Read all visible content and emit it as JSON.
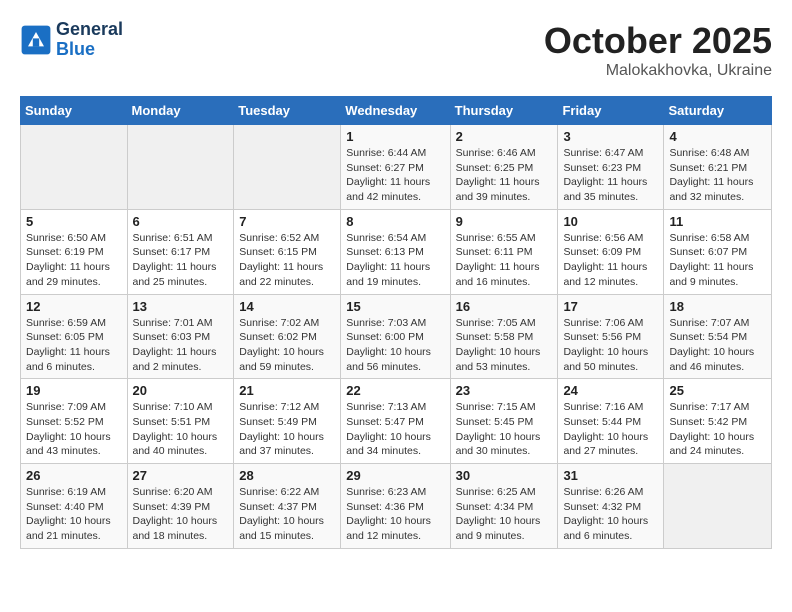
{
  "header": {
    "logo_line1": "General",
    "logo_line2": "Blue",
    "title": "October 2025",
    "subtitle": "Malokakhovka, Ukraine"
  },
  "weekdays": [
    "Sunday",
    "Monday",
    "Tuesday",
    "Wednesday",
    "Thursday",
    "Friday",
    "Saturday"
  ],
  "weeks": [
    [
      {
        "day": "",
        "info": ""
      },
      {
        "day": "",
        "info": ""
      },
      {
        "day": "",
        "info": ""
      },
      {
        "day": "1",
        "info": "Sunrise: 6:44 AM\nSunset: 6:27 PM\nDaylight: 11 hours and 42 minutes."
      },
      {
        "day": "2",
        "info": "Sunrise: 6:46 AM\nSunset: 6:25 PM\nDaylight: 11 hours and 39 minutes."
      },
      {
        "day": "3",
        "info": "Sunrise: 6:47 AM\nSunset: 6:23 PM\nDaylight: 11 hours and 35 minutes."
      },
      {
        "day": "4",
        "info": "Sunrise: 6:48 AM\nSunset: 6:21 PM\nDaylight: 11 hours and 32 minutes."
      }
    ],
    [
      {
        "day": "5",
        "info": "Sunrise: 6:50 AM\nSunset: 6:19 PM\nDaylight: 11 hours and 29 minutes."
      },
      {
        "day": "6",
        "info": "Sunrise: 6:51 AM\nSunset: 6:17 PM\nDaylight: 11 hours and 25 minutes."
      },
      {
        "day": "7",
        "info": "Sunrise: 6:52 AM\nSunset: 6:15 PM\nDaylight: 11 hours and 22 minutes."
      },
      {
        "day": "8",
        "info": "Sunrise: 6:54 AM\nSunset: 6:13 PM\nDaylight: 11 hours and 19 minutes."
      },
      {
        "day": "9",
        "info": "Sunrise: 6:55 AM\nSunset: 6:11 PM\nDaylight: 11 hours and 16 minutes."
      },
      {
        "day": "10",
        "info": "Sunrise: 6:56 AM\nSunset: 6:09 PM\nDaylight: 11 hours and 12 minutes."
      },
      {
        "day": "11",
        "info": "Sunrise: 6:58 AM\nSunset: 6:07 PM\nDaylight: 11 hours and 9 minutes."
      }
    ],
    [
      {
        "day": "12",
        "info": "Sunrise: 6:59 AM\nSunset: 6:05 PM\nDaylight: 11 hours and 6 minutes."
      },
      {
        "day": "13",
        "info": "Sunrise: 7:01 AM\nSunset: 6:03 PM\nDaylight: 11 hours and 2 minutes."
      },
      {
        "day": "14",
        "info": "Sunrise: 7:02 AM\nSunset: 6:02 PM\nDaylight: 10 hours and 59 minutes."
      },
      {
        "day": "15",
        "info": "Sunrise: 7:03 AM\nSunset: 6:00 PM\nDaylight: 10 hours and 56 minutes."
      },
      {
        "day": "16",
        "info": "Sunrise: 7:05 AM\nSunset: 5:58 PM\nDaylight: 10 hours and 53 minutes."
      },
      {
        "day": "17",
        "info": "Sunrise: 7:06 AM\nSunset: 5:56 PM\nDaylight: 10 hours and 50 minutes."
      },
      {
        "day": "18",
        "info": "Sunrise: 7:07 AM\nSunset: 5:54 PM\nDaylight: 10 hours and 46 minutes."
      }
    ],
    [
      {
        "day": "19",
        "info": "Sunrise: 7:09 AM\nSunset: 5:52 PM\nDaylight: 10 hours and 43 minutes."
      },
      {
        "day": "20",
        "info": "Sunrise: 7:10 AM\nSunset: 5:51 PM\nDaylight: 10 hours and 40 minutes."
      },
      {
        "day": "21",
        "info": "Sunrise: 7:12 AM\nSunset: 5:49 PM\nDaylight: 10 hours and 37 minutes."
      },
      {
        "day": "22",
        "info": "Sunrise: 7:13 AM\nSunset: 5:47 PM\nDaylight: 10 hours and 34 minutes."
      },
      {
        "day": "23",
        "info": "Sunrise: 7:15 AM\nSunset: 5:45 PM\nDaylight: 10 hours and 30 minutes."
      },
      {
        "day": "24",
        "info": "Sunrise: 7:16 AM\nSunset: 5:44 PM\nDaylight: 10 hours and 27 minutes."
      },
      {
        "day": "25",
        "info": "Sunrise: 7:17 AM\nSunset: 5:42 PM\nDaylight: 10 hours and 24 minutes."
      }
    ],
    [
      {
        "day": "26",
        "info": "Sunrise: 6:19 AM\nSunset: 4:40 PM\nDaylight: 10 hours and 21 minutes."
      },
      {
        "day": "27",
        "info": "Sunrise: 6:20 AM\nSunset: 4:39 PM\nDaylight: 10 hours and 18 minutes."
      },
      {
        "day": "28",
        "info": "Sunrise: 6:22 AM\nSunset: 4:37 PM\nDaylight: 10 hours and 15 minutes."
      },
      {
        "day": "29",
        "info": "Sunrise: 6:23 AM\nSunset: 4:36 PM\nDaylight: 10 hours and 12 minutes."
      },
      {
        "day": "30",
        "info": "Sunrise: 6:25 AM\nSunset: 4:34 PM\nDaylight: 10 hours and 9 minutes."
      },
      {
        "day": "31",
        "info": "Sunrise: 6:26 AM\nSunset: 4:32 PM\nDaylight: 10 hours and 6 minutes."
      },
      {
        "day": "",
        "info": ""
      }
    ]
  ]
}
